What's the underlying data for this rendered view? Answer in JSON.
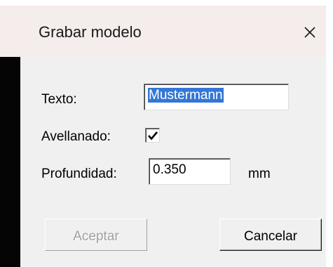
{
  "dialog": {
    "title": "Grabar modelo",
    "close_icon": "close-icon"
  },
  "form": {
    "texto_label": "Texto:",
    "texto_value": "Mustermann",
    "avellanado_label": "Avellanado:",
    "avellanado_checked": true,
    "profundidad_label": "Profundidad:",
    "profundidad_value": "0.350",
    "profundidad_unit": "mm"
  },
  "buttons": {
    "accept_label": "Aceptar",
    "accept_enabled": false,
    "cancel_label": "Cancelar"
  },
  "colors": {
    "selection": "#3377d6",
    "titlebar": "#f5ecec",
    "dialog_bg": "#f0f0f0"
  }
}
